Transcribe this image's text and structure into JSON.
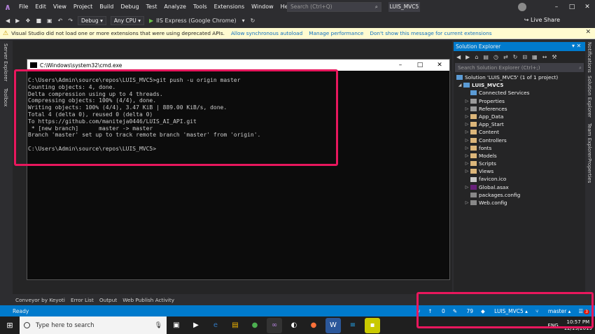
{
  "menu": {
    "items": [
      "File",
      "Edit",
      "View",
      "Project",
      "Build",
      "Debug",
      "Test",
      "Analyze",
      "Tools",
      "Extensions",
      "Window",
      "Help"
    ],
    "search_placeholder": "Search (Ctrl+Q)",
    "project_title": "LUIS_MVC5",
    "live_share": "Live Share"
  },
  "toolbar": {
    "config": "Debug",
    "platform": "Any CPU",
    "run_target": "IIS Express (Google Chrome)"
  },
  "infobar": {
    "message": "Visual Studio did not load one or more extensions that were using deprecated APIs.",
    "link1": "Allow synchronous autoload",
    "link2": "Manage performance",
    "link3": "Don't show this message for current extensions"
  },
  "left_tabs": {
    "server_explorer": "Server Explorer",
    "toolbox": "Toolbox"
  },
  "cmd": {
    "title": "C:\\Windows\\system32\\cmd.exe",
    "lines": [
      "C:\\Users\\Admin\\source\\repos\\LUIS_MVC5>git push -u origin master",
      "Counting objects: 4, done.",
      "Delta compression using up to 4 threads.",
      "Compressing objects: 100% (4/4), done.",
      "Writing objects: 100% (4/4), 3.47 KiB | 889.00 KiB/s, done.",
      "Total 4 (delta 0), reused 0 (delta 0)",
      "To https://github.com/maniteja0446/LUIS_AI_API.git",
      " * [new branch]      master -> master",
      "Branch 'master' set up to track remote branch 'master' from 'origin'.",
      "",
      "C:\\Users\\Admin\\source\\repos\\LUIS_MVC5>"
    ]
  },
  "bottom_tabs": [
    "Conveyor by Keyoti",
    "Error List",
    "Output",
    "Web Publish Activity"
  ],
  "solution_explorer": {
    "title": "Solution Explorer",
    "search_placeholder": "Search Solution Explorer (Ctrl+;)",
    "solution": "Solution 'LUIS_MVC5' (1 of 1 project)",
    "project": "LUIS_MVC5",
    "items": [
      {
        "label": "Connected Services",
        "kind": "web",
        "expandable": false
      },
      {
        "label": "Properties",
        "kind": "ref",
        "expandable": true
      },
      {
        "label": "References",
        "kind": "ref",
        "expandable": true
      },
      {
        "label": "App_Data",
        "kind": "folder",
        "expandable": true
      },
      {
        "label": "App_Start",
        "kind": "folder",
        "expandable": true
      },
      {
        "label": "Content",
        "kind": "folder",
        "expandable": true
      },
      {
        "label": "Controllers",
        "kind": "folder",
        "expandable": true
      },
      {
        "label": "fonts",
        "kind": "folder",
        "expandable": true
      },
      {
        "label": "Models",
        "kind": "folder",
        "expandable": true
      },
      {
        "label": "Scripts",
        "kind": "folder",
        "expandable": true
      },
      {
        "label": "Views",
        "kind": "folder",
        "expandable": true
      },
      {
        "label": "favicon.ico",
        "kind": "file",
        "expandable": false
      },
      {
        "label": "Global.asax",
        "kind": "csfile",
        "expandable": true
      },
      {
        "label": "packages.config",
        "kind": "cfg",
        "expandable": false
      },
      {
        "label": "Web.config",
        "kind": "cfg",
        "expandable": true
      }
    ]
  },
  "right_tabs": {
    "notifications": "Notifications",
    "solution_explorer": "Solution Explorer",
    "team_explorer": "Team Explorer",
    "properties": "Properties"
  },
  "status": {
    "ready": "Ready",
    "up_count": "0",
    "edit_count": "79",
    "repo": "LUIS_MVC5",
    "branch": "master",
    "notif": "3"
  },
  "taskbar": {
    "search_placeholder": "Type here to search",
    "lang": "ENG",
    "time": "10:57 PM",
    "date": "12/19/2019"
  },
  "colors": {
    "accent": "#007acc",
    "highlight": "#e8175d",
    "warning_bg": "#fffbd0"
  }
}
